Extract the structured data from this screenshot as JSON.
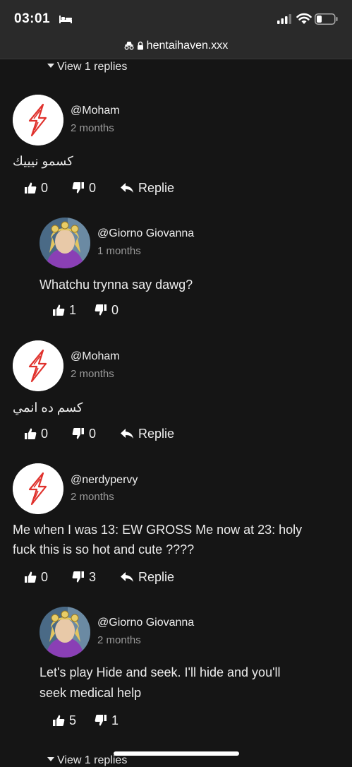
{
  "status": {
    "time": "03:01"
  },
  "browser": {
    "url": "hentaihaven.xxx"
  },
  "view_replies_label": "View 1 replies",
  "comments": [
    {
      "user": "@Moham",
      "time": "2 months",
      "text": "كسمو نيييك",
      "likes": "0",
      "dislikes": "0",
      "reply_label": "Replie"
    },
    {
      "user": "@Giorno Giovanna",
      "time": "1 months",
      "text": "Whatchu trynna say dawg?",
      "likes": "1",
      "dislikes": "0"
    },
    {
      "user": "@Moham",
      "time": "2 months",
      "text": "كسم ده انمي",
      "likes": "0",
      "dislikes": "0",
      "reply_label": "Replie"
    },
    {
      "user": "@nerdypervy",
      "time": "2 months",
      "text_line1": "Me when I was 13: EW GROSS  Me now at 23: holy",
      "text_line2": "fuck this is so hot and cute ????",
      "likes": "0",
      "dislikes": "3",
      "reply_label": "Replie"
    },
    {
      "user": "@Giorno Giovanna",
      "time": "2 months",
      "text_line1": "Let's play Hide and seek. I'll hide and you'll",
      "text_line2": "seek medical help",
      "likes": "5",
      "dislikes": "1"
    }
  ],
  "colors": {
    "background": "#151515",
    "bar": "#2a2a2a",
    "logo_red": "#e0322d",
    "text": "#e8e8e8",
    "muted": "#9a9a9a"
  }
}
